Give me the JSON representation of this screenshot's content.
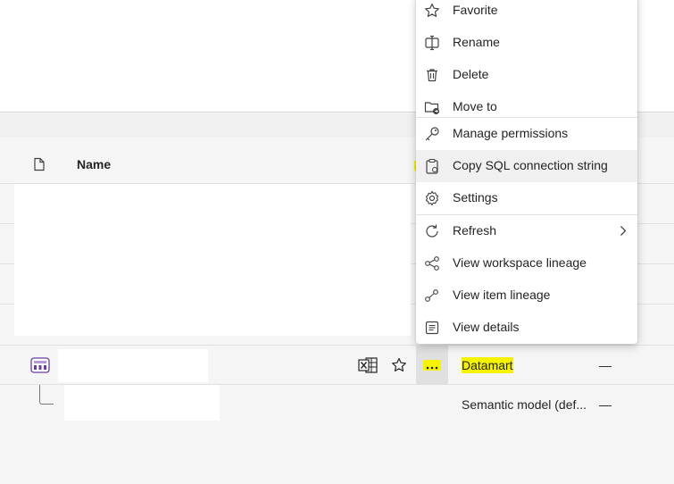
{
  "table": {
    "name_header": "Name"
  },
  "row": {
    "type": "Datamart",
    "endorsement": "—"
  },
  "child": {
    "type": "Semantic model (def...",
    "endorsement": "—"
  },
  "menu": {
    "items": [
      {
        "label": "Favorite",
        "icon": "star-icon"
      },
      {
        "label": "Rename",
        "icon": "rename-icon"
      },
      {
        "label": "Delete",
        "icon": "trash-icon"
      },
      {
        "label": "Move to",
        "icon": "folder-move-icon"
      },
      {
        "label": "Manage permissions",
        "icon": "key-icon"
      },
      {
        "label": "Copy SQL connection string",
        "icon": "clipboard-icon"
      },
      {
        "label": "Settings",
        "icon": "gear-icon"
      },
      {
        "label": "Refresh",
        "icon": "refresh-icon"
      },
      {
        "label": "View workspace lineage",
        "icon": "lineage-icon"
      },
      {
        "label": "View item lineage",
        "icon": "item-lineage-icon"
      },
      {
        "label": "View details",
        "icon": "details-icon"
      }
    ]
  },
  "colors": {
    "highlight": "#f5f300",
    "datamart_icon": "#6b3fa0"
  }
}
